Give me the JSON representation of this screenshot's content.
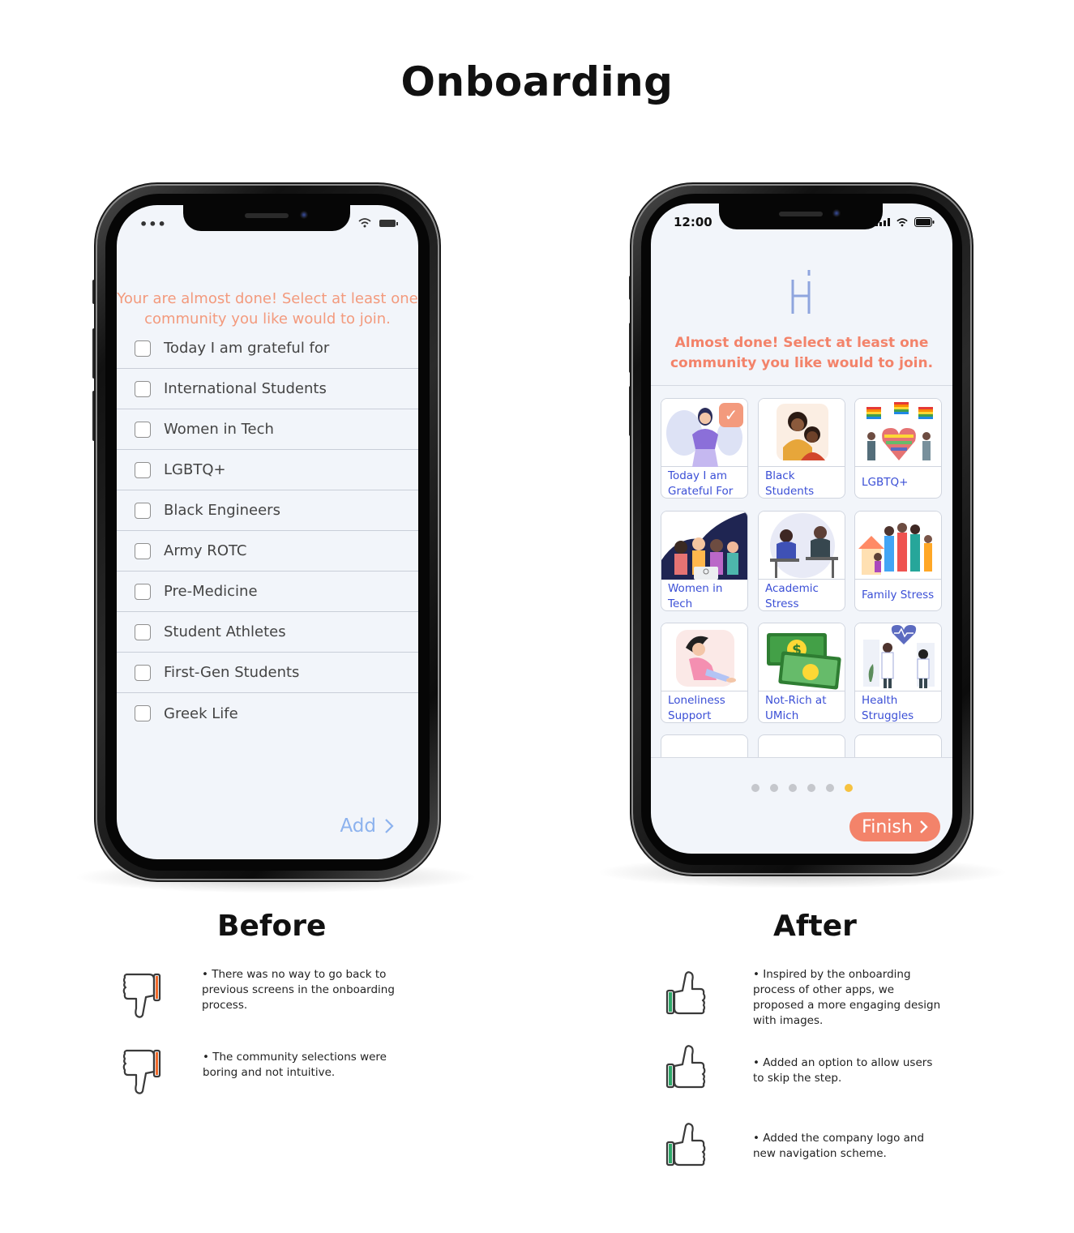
{
  "title": "Onboarding",
  "before": {
    "heading": "Before",
    "status": {
      "dots": "•••"
    },
    "prompt_line1": "Your are almost done! Select at least one",
    "prompt_line2": "community you like would to join.",
    "items": [
      "Today I am grateful for",
      "International Students",
      "Women in Tech",
      "LGBTQ+",
      "Black Engineers",
      "Army ROTC",
      "Pre-Medicine",
      "Student Athletes",
      "First-Gen Students",
      "Greek Life"
    ],
    "add_label": "Add",
    "notes": [
      {
        "line1": "• There was no way to go back to",
        "line2": "previous screens in the onboarding",
        "line3": "process."
      },
      {
        "line1": "• The community selections were",
        "line2": "boring and not intuitive."
      }
    ]
  },
  "after": {
    "heading": "After",
    "status": {
      "time": "12:00"
    },
    "prompt_line1": "Almost done! Select at least one",
    "prompt_line2": "community you like would to join.",
    "cards": [
      {
        "line1": "Today I am",
        "line2": "Grateful For"
      },
      {
        "line1": "Black",
        "line2": "Students"
      },
      {
        "line1": "LGBTQ+"
      },
      {
        "line1": "Women in",
        "line2": "Tech"
      },
      {
        "line1": "Academic",
        "line2": "Stress"
      },
      {
        "line1": "Family Stress"
      },
      {
        "line1": "Loneliness",
        "line2": "Support"
      },
      {
        "line1": "Not-Rich at",
        "line2": "UMich"
      },
      {
        "line1": "Health",
        "line2": "Struggles"
      }
    ],
    "pager": {
      "count": 6,
      "active": 6
    },
    "finish_label": "Finish",
    "notes": [
      {
        "line1": "• Inspired by the onboarding",
        "line2": "process of other apps, we",
        "line3": "proposed a more engaging design",
        "line4": "with images."
      },
      {
        "line1": "• Added an option to allow users",
        "line2": "to skip the step."
      },
      {
        "line1": "• Added the company logo and",
        "line2": "new navigation scheme."
      }
    ]
  },
  "colors": {
    "before_prompt": "#f39a7d",
    "after_prompt": "#f3836a",
    "add_button": "#8cb2ee",
    "finish_button": "#f3836a",
    "card_label": "#3b4fd6",
    "pager_active": "#f6c240",
    "thumbs_down_accent": "#f26b2c",
    "thumbs_up_accent": "#2fa86a"
  }
}
